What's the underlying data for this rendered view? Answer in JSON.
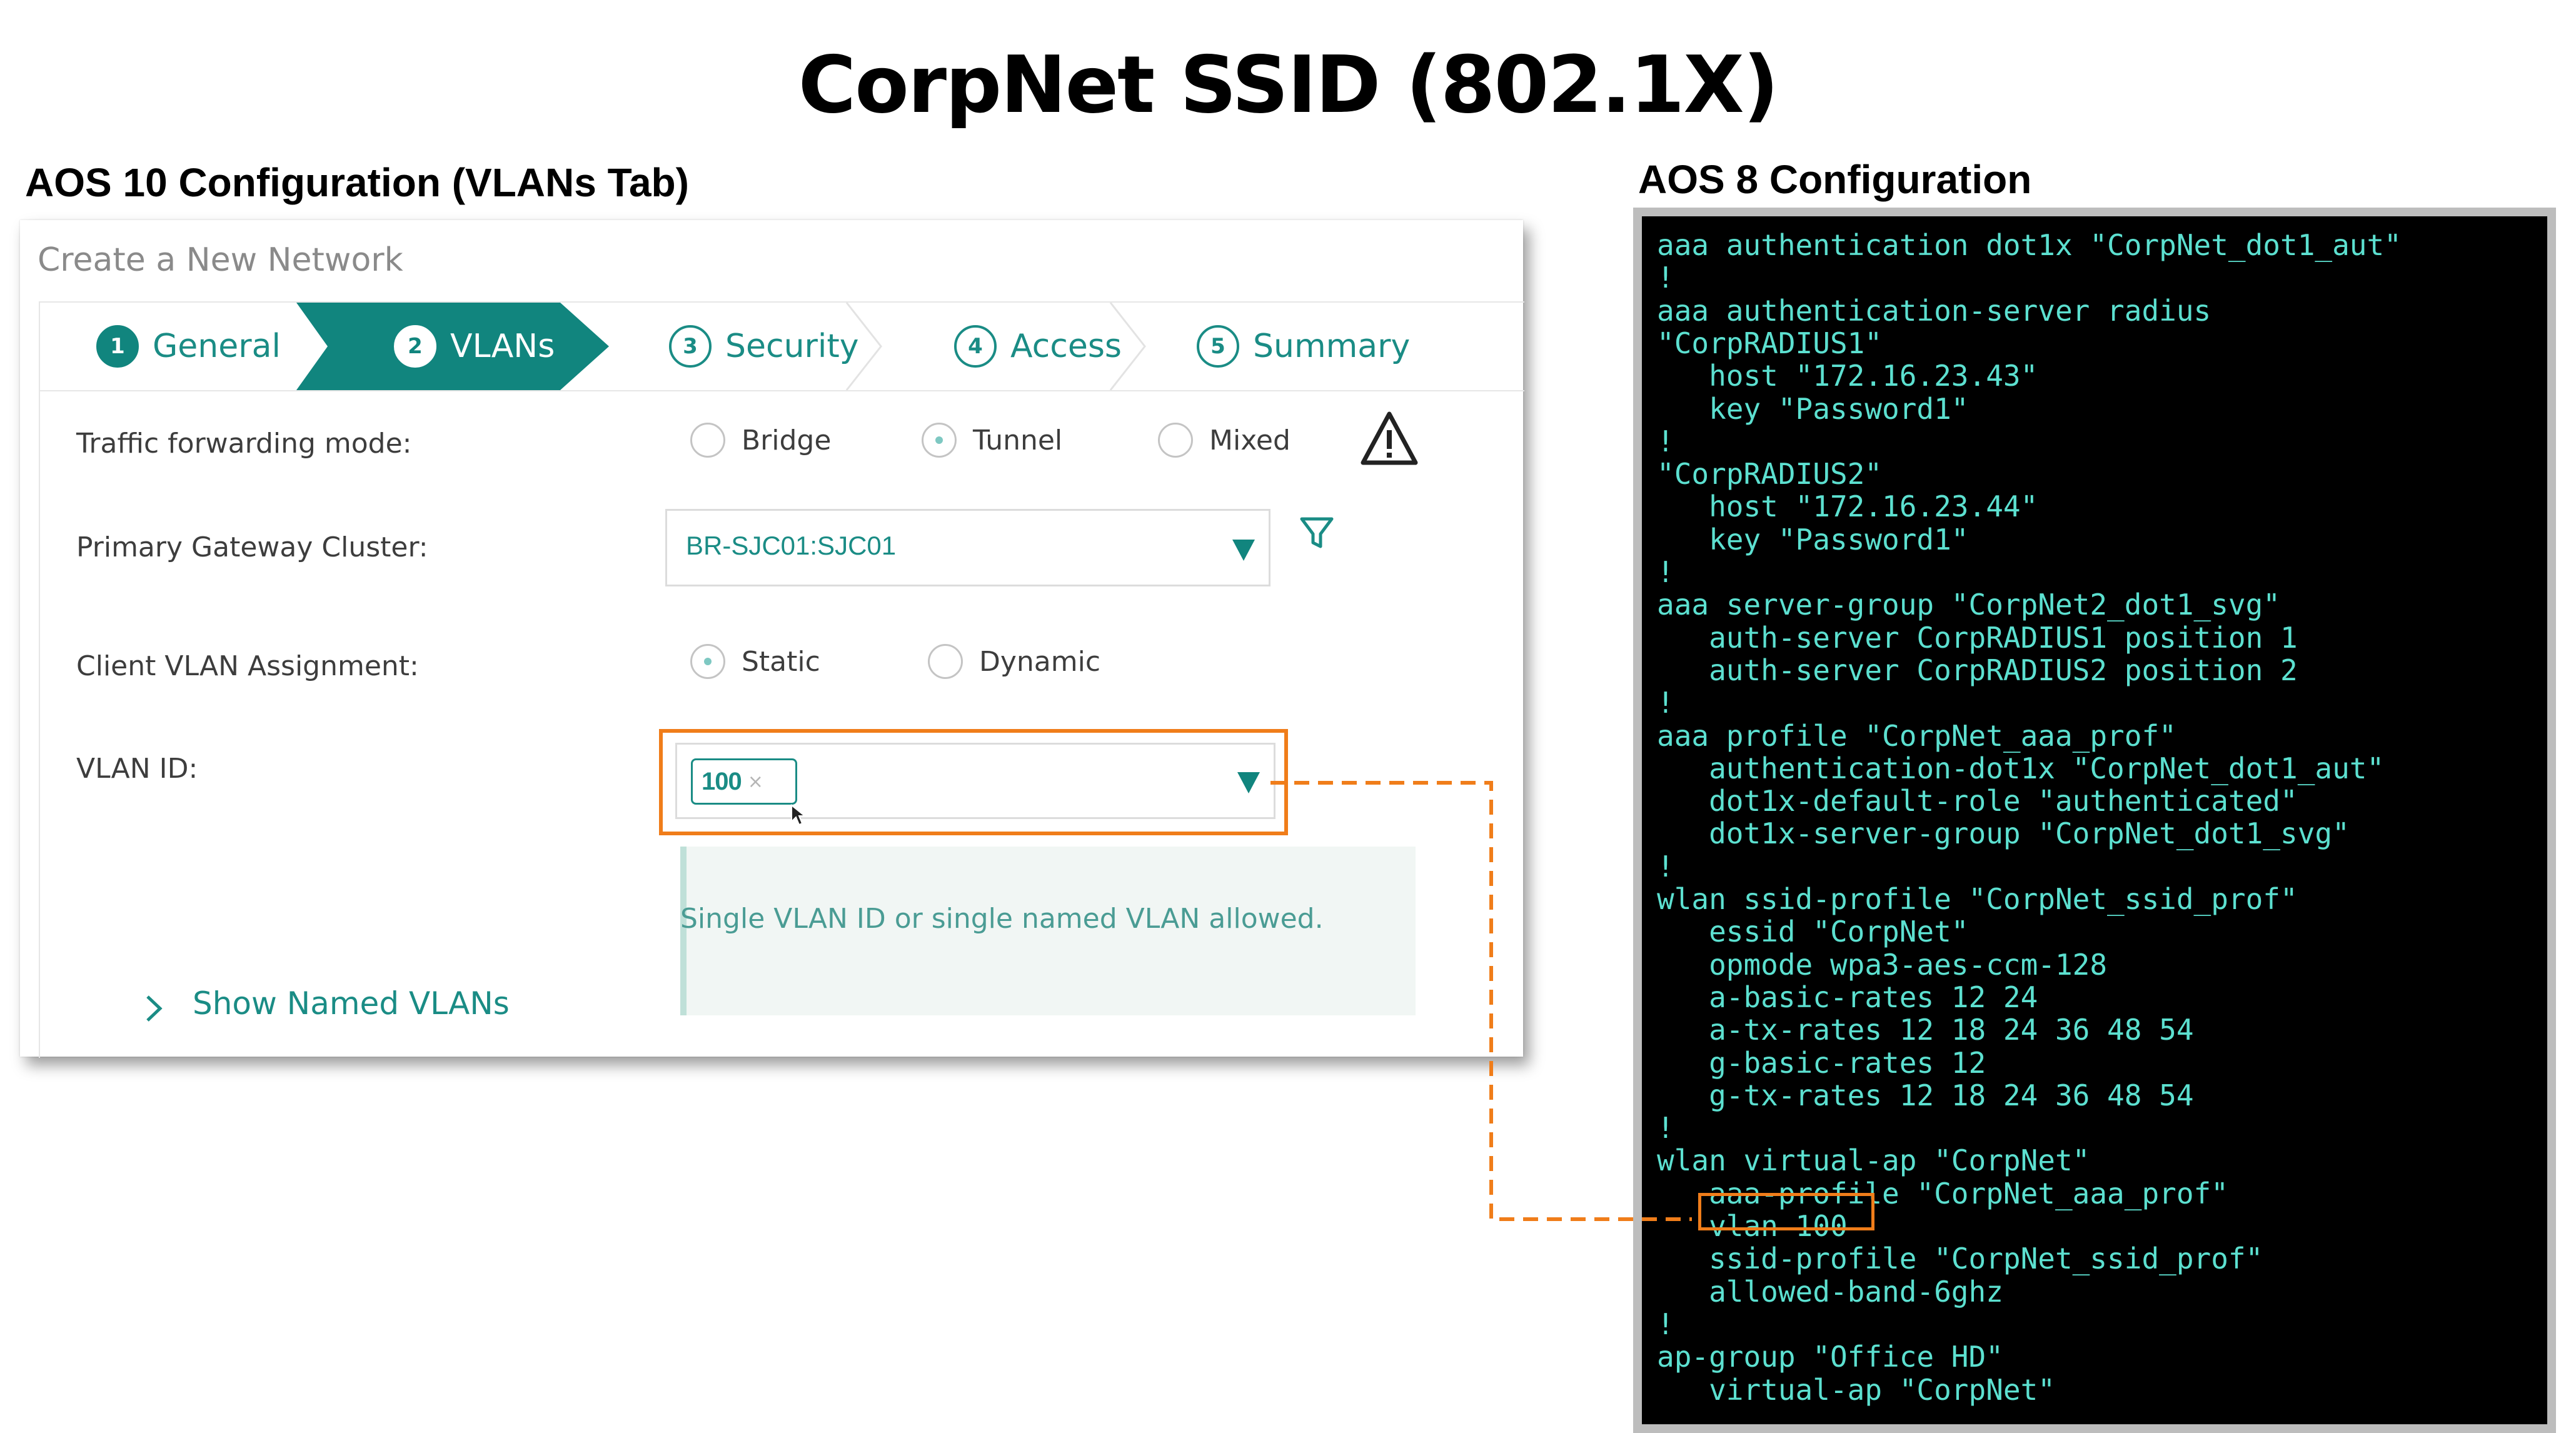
{
  "title": "CorpNet SSID (802.1X)",
  "left_heading": "AOS 10 Configuration (VLANs Tab)",
  "right_heading": "AOS 8 Configuration",
  "panel": {
    "header": "Create a New Network",
    "steps": [
      {
        "num": "1",
        "label": "General"
      },
      {
        "num": "2",
        "label": "VLANs",
        "active": true
      },
      {
        "num": "3",
        "label": "Security"
      },
      {
        "num": "4",
        "label": "Access"
      },
      {
        "num": "5",
        "label": "Summary"
      }
    ],
    "traffic_label": "Traffic forwarding mode:",
    "traffic_options": [
      "Bridge",
      "Tunnel",
      "Mixed"
    ],
    "traffic_selected": "Tunnel",
    "gateway_label": "Primary Gateway Cluster:",
    "gateway_value": "BR-SJC01:SJC01",
    "client_vlan_label": "Client VLAN Assignment:",
    "client_vlan_options": [
      "Static",
      "Dynamic"
    ],
    "client_vlan_selected": "Static",
    "vlan_id_label": "VLAN ID:",
    "vlan_chip": "100",
    "vlan_chip_remove": "×",
    "hint": "Single VLAN ID or single named VLAN allowed.",
    "show_named": "Show Named VLANs",
    "icons": [
      "warning-icon",
      "filter-icon",
      "chevron-right-icon",
      "dropdown-caret-icon",
      "cursor-icon"
    ]
  },
  "config_lines": [
    "aaa authentication dot1x \"CorpNet_dot1_aut\"",
    "!",
    "aaa authentication-server radius",
    "\"CorpRADIUS1\"",
    "   host \"172.16.23.43\"",
    "   key \"Password1\"",
    "!",
    "\"CorpRADIUS2\"",
    "   host \"172.16.23.44\"",
    "   key \"Password1\"",
    "!",
    "aaa server-group \"CorpNet2_dot1_svg\"",
    "   auth-server CorpRADIUS1 position 1",
    "   auth-server CorpRADIUS2 position 2",
    "!",
    "aaa profile \"CorpNet_aaa_prof\"",
    "   authentication-dot1x \"CorpNet_dot1_aut\"",
    "   dot1x-default-role \"authenticated\"",
    "   dot1x-server-group \"CorpNet_dot1_svg\"",
    "!",
    "wlan ssid-profile \"CorpNet_ssid_prof\"",
    "   essid \"CorpNet\"",
    "   opmode wpa3-aes-ccm-128",
    "   a-basic-rates 12 24",
    "   a-tx-rates 12 18 24 36 48 54",
    "   g-basic-rates 12",
    "   g-tx-rates 12 18 24 36 48 54",
    "!",
    "wlan virtual-ap \"CorpNet\"",
    "   aaa-profile \"CorpNet_aaa_prof\"",
    "   vlan 100",
    "   ssid-profile \"CorpNet_ssid_prof\"",
    "   allowed-band-6ghz",
    "!",
    "ap-group \"Office HD\"",
    "   virtual-ap \"CorpNet\""
  ],
  "highlighted_line": "vlan 100",
  "colors": {
    "accent": "#11857e",
    "highlight": "#f07d1a",
    "terminal_bg": "#000000",
    "terminal_text": "#5ce0d0"
  }
}
